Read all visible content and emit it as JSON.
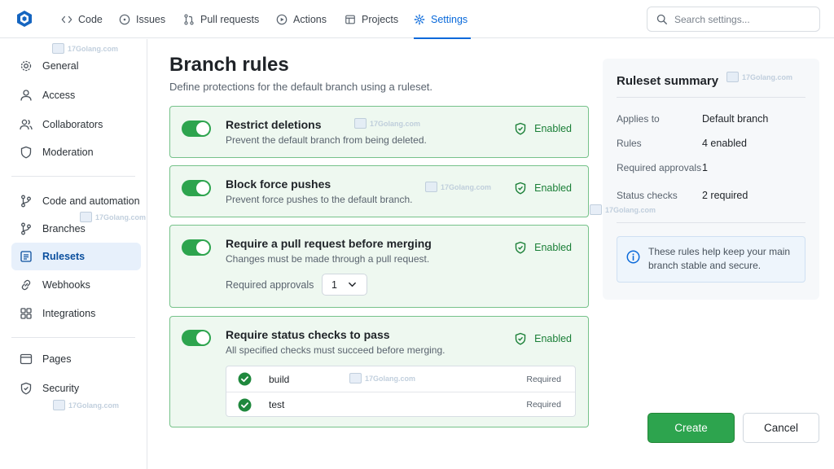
{
  "topnav": {
    "items": [
      {
        "label": "Code",
        "icon": "code-icon"
      },
      {
        "label": "Issues",
        "icon": "issue-icon"
      },
      {
        "label": "Pull requests",
        "icon": "pull-request-icon"
      },
      {
        "label": "Actions",
        "icon": "play-icon"
      },
      {
        "label": "Projects",
        "icon": "table-icon"
      },
      {
        "label": "Settings",
        "icon": "gear-icon",
        "active": true
      }
    ],
    "search_placeholder": "Search settings..."
  },
  "sidebar": {
    "items": [
      {
        "label": "General",
        "icon": "gear-icon"
      },
      {
        "label": "Access",
        "icon": "person-icon"
      },
      {
        "label": "Collaborators",
        "icon": "people-icon"
      },
      {
        "label": "Moderation",
        "icon": "shield-icon"
      },
      {
        "label": "Code and automation",
        "icon": "branch-icon"
      },
      {
        "label": "Branches",
        "icon": "branch-icon"
      },
      {
        "label": "Rulesets",
        "icon": "list-icon",
        "active": true
      },
      {
        "label": "Webhooks",
        "icon": "link-icon"
      },
      {
        "label": "Integrations",
        "icon": "apps-icon"
      },
      {
        "label": "Pages",
        "icon": "browser-icon"
      },
      {
        "label": "Security",
        "icon": "shield-icon"
      }
    ]
  },
  "main": {
    "title": "Branch rules",
    "subtitle": "Define protections for the default branch using a ruleset.",
    "rules": [
      {
        "title": "Restrict deletions",
        "description": "Prevent the default branch from being deleted.",
        "status": "Enabled",
        "enabled": true
      },
      {
        "title": "Block force pushes",
        "description": "Prevent force pushes to the default branch.",
        "status": "Enabled",
        "enabled": true
      },
      {
        "title": "Require a pull request before merging",
        "description": "Changes must be made through a pull request.",
        "status": "Enabled",
        "enabled": true,
        "approvals_label": "Required approvals",
        "approvals_value": "1"
      },
      {
        "title": "Require status checks to pass",
        "description": "All specified checks must succeed before merging.",
        "status": "Enabled",
        "enabled": true,
        "checks": [
          {
            "name": "build",
            "state": "Required"
          },
          {
            "name": "test",
            "state": "Required"
          }
        ]
      }
    ]
  },
  "summary": {
    "title": "Ruleset summary",
    "rows": [
      {
        "label": "Applies to",
        "value": "Default branch"
      },
      {
        "label": "Rules",
        "value": "4 enabled"
      },
      {
        "label": "Required approvals",
        "value": "1"
      },
      {
        "label": "Status checks",
        "value": "2 required"
      }
    ],
    "info": "These rules help keep your main branch stable and secure."
  },
  "actions": {
    "create_label": "Create",
    "cancel_label": "Cancel"
  },
  "watermark": {
    "text": "17Golang.com"
  },
  "colors": {
    "accent": "#0969da",
    "success": "#2da44e",
    "card_bg": "#eef8f0",
    "card_border": "#76c28a"
  }
}
